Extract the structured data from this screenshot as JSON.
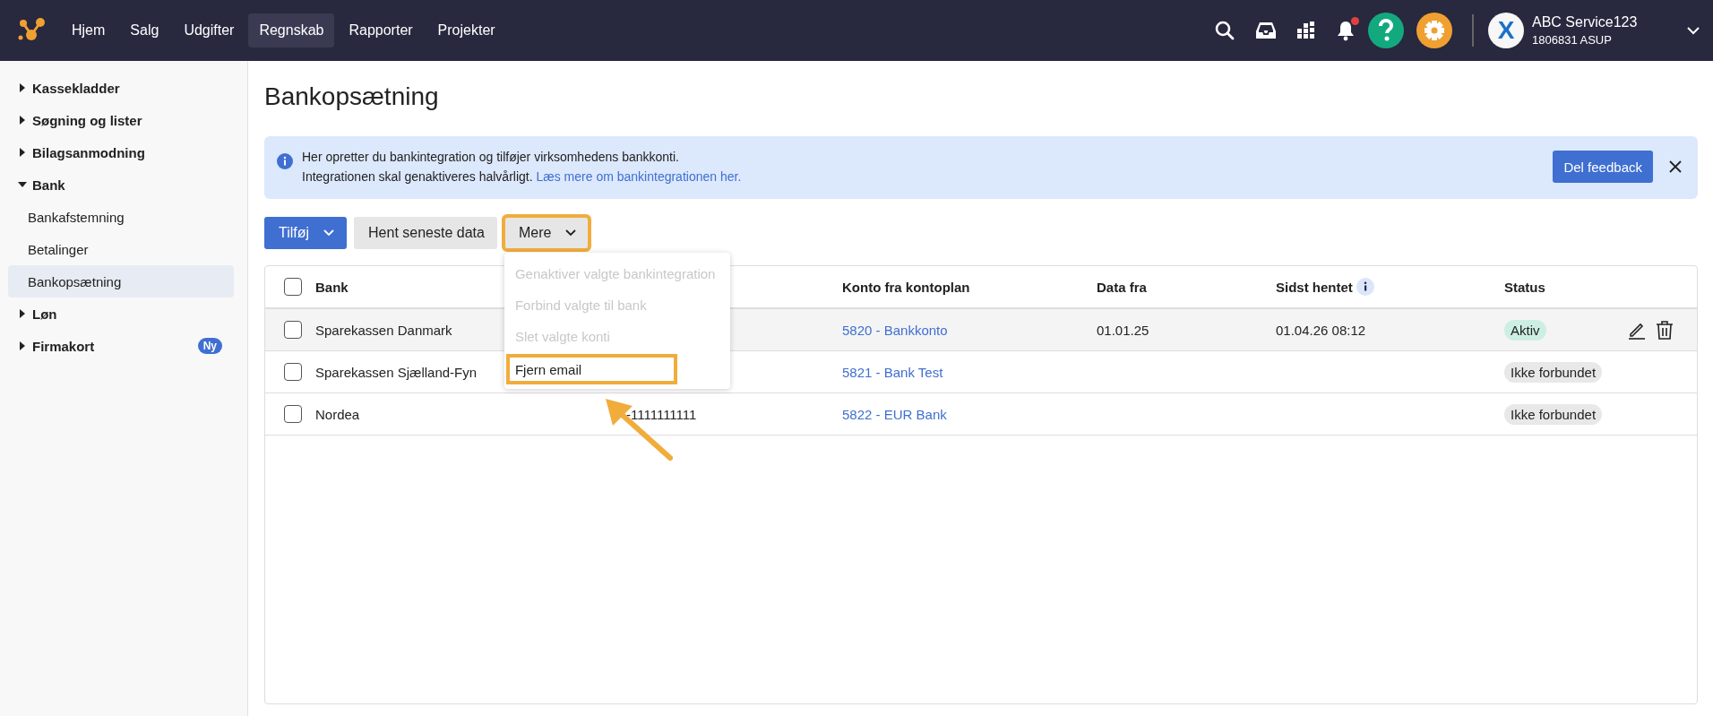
{
  "nav": {
    "items": [
      {
        "label": "Hjem",
        "selected": false
      },
      {
        "label": "Salg",
        "selected": false
      },
      {
        "label": "Udgifter",
        "selected": false
      },
      {
        "label": "Regnskab",
        "selected": true
      },
      {
        "label": "Rapporter",
        "selected": false
      },
      {
        "label": "Projekter",
        "selected": false
      }
    ],
    "notifications_unread": true,
    "account": {
      "avatar": "X",
      "name": "ABC Service123",
      "id": "1806831 ASUP"
    }
  },
  "sidebar": {
    "items": [
      {
        "label": "Kassekladder",
        "kind": "group",
        "expanded": false
      },
      {
        "label": "Søgning og lister",
        "kind": "group",
        "expanded": false
      },
      {
        "label": "Bilagsanmodning",
        "kind": "group",
        "expanded": false
      },
      {
        "label": "Bank",
        "kind": "group",
        "expanded": true
      },
      {
        "label": "Bankafstemning",
        "kind": "sub",
        "selected": false
      },
      {
        "label": "Betalinger",
        "kind": "sub",
        "selected": false
      },
      {
        "label": "Bankopsætning",
        "kind": "sub",
        "selected": true
      },
      {
        "label": "Løn",
        "kind": "group",
        "expanded": false
      },
      {
        "label": "Firmakort",
        "kind": "group",
        "expanded": false,
        "badge": "Ny"
      }
    ]
  },
  "page_title": "Bankopsætning",
  "banner": {
    "line_1": "Her opretter du bankintegration og tilføjer virksomhedens bankkonti.",
    "line_2": "Integrationen skal genaktiveres halvårligt.",
    "link": "Læs mere om bankintegrationen her.",
    "button": "Del feedback"
  },
  "toolbar": {
    "add": "Tilføj",
    "fetch": "Hent seneste data",
    "more": {
      "label": "Mere",
      "highlighted": true,
      "menu": [
        {
          "label": "Genaktiver valgte bankintegration",
          "disabled": true,
          "highlighted": false
        },
        {
          "label": "Forbind valgte til bank",
          "disabled": true,
          "highlighted": false
        },
        {
          "label": "Slet valgte konti",
          "disabled": true,
          "highlighted": false
        },
        {
          "label": "Fjern email",
          "disabled": false,
          "highlighted": true
        }
      ]
    }
  },
  "table": {
    "all_checked": false,
    "columns": [
      "Bank",
      "Konto fra kontoplan",
      "Data fra",
      "Sidst hentet",
      "Status"
    ],
    "rows": [
      {
        "checked": false,
        "hovered": true,
        "bank": "Sparekassen Danmark",
        "konto": "5820 - Bankkonto",
        "data_fra": "01.01.25",
        "sidst_hentet": "01.04.26 08:12",
        "status": {
          "label": "Aktiv",
          "kind": "active"
        }
      },
      {
        "checked": false,
        "hovered": false,
        "bank": "Sparekassen Sjælland-Fyn",
        "konto": "5821 - Bank Test",
        "status": {
          "label": "Ikke forbundet",
          "kind": "inactive"
        }
      },
      {
        "checked": false,
        "hovered": false,
        "bank": "Nordea",
        "column_2": "-1111111111",
        "konto": "5822 - EUR Bank",
        "status": {
          "label": "Ikke forbundet",
          "kind": "inactive"
        }
      }
    ]
  }
}
